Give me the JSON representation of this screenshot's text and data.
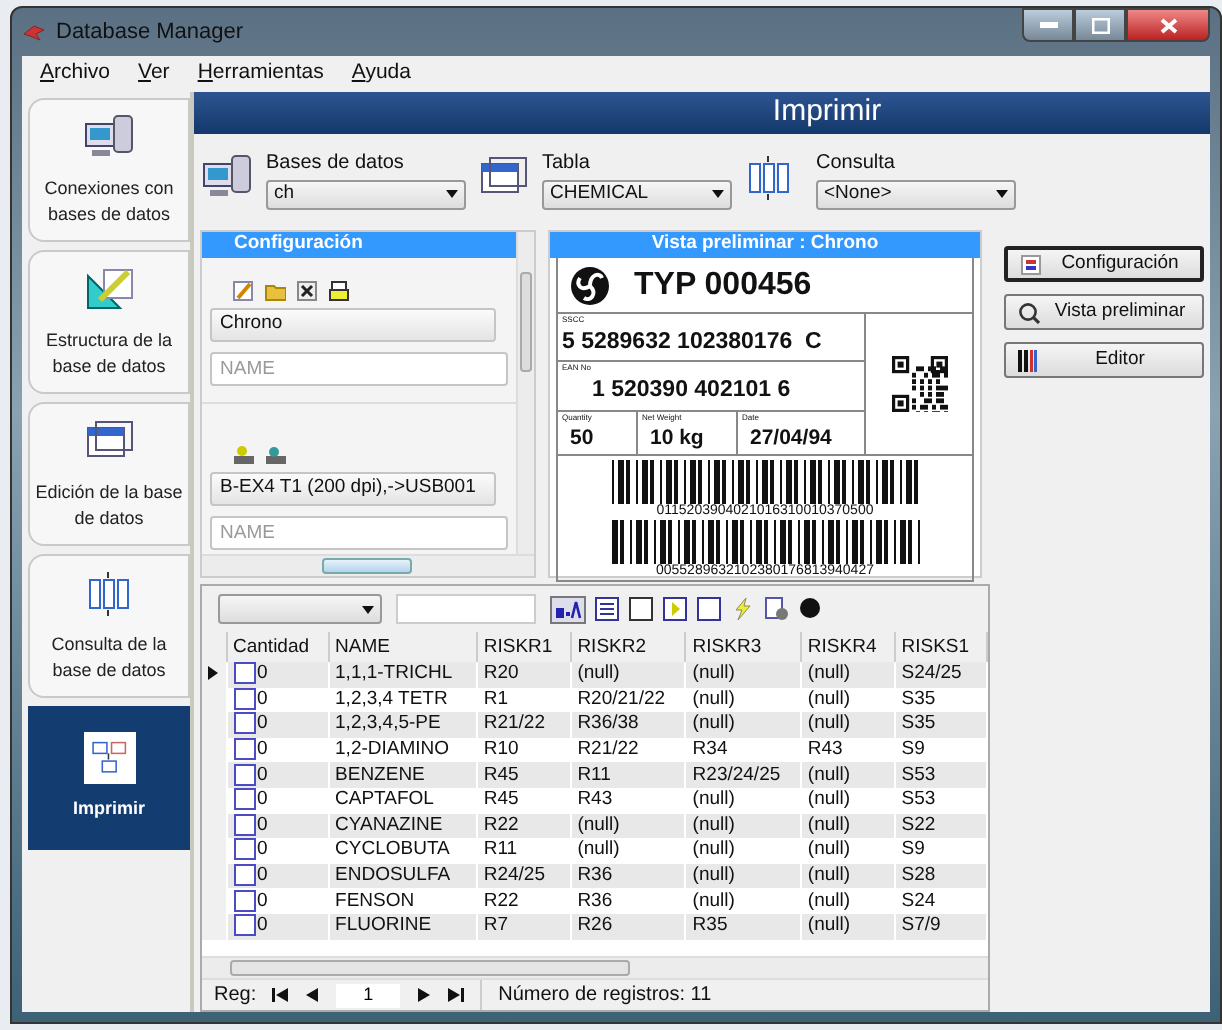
{
  "window": {
    "title": "Database Manager"
  },
  "menu": [
    {
      "label": "Archivo"
    },
    {
      "label": "Ver"
    },
    {
      "label": "Herramientas"
    },
    {
      "label": "Ayuda"
    }
  ],
  "sidebar": {
    "items": [
      {
        "label": "Conexiones con bases de datos",
        "selected": false
      },
      {
        "label": "Estructura de la base de datos",
        "selected": false
      },
      {
        "label": "Edición de la base de datos",
        "selected": false
      },
      {
        "label": "Consulta de la base de datos",
        "selected": false
      },
      {
        "label": "Imprimir",
        "selected": true
      }
    ]
  },
  "header": {
    "title": "Imprimir"
  },
  "selectors": [
    {
      "label": "Bases de datos",
      "value": "ch"
    },
    {
      "label": "Tabla",
      "value": "CHEMICAL"
    },
    {
      "label": "Consulta",
      "value": "<None>"
    }
  ],
  "config_panel": {
    "title": "Configuración",
    "sections": [
      {
        "value": "Chrono",
        "placeholder": "NAME"
      },
      {
        "value": "B-EX4 T1 (200 dpi),->USB001",
        "placeholder": "NAME"
      }
    ]
  },
  "preview": {
    "title": "Vista preliminar : Chrono",
    "label": {
      "heading": "TYP 000456",
      "sscc_label": "SSCC",
      "sscc": "5 5289632 102380176  C",
      "ean_label": "EAN No",
      "ean": "1 520390 402101 6",
      "quantity_label": "Quantity",
      "quantity": "50",
      "weight_label": "Net Weight",
      "weight": "10 kg",
      "date_label": "Date",
      "date": "27/04/94",
      "barcode_1": "0115203904021016310010370500",
      "barcode_2": "0055289632102380176813940427"
    }
  },
  "actions": [
    {
      "label": "Configuración",
      "focused": true
    },
    {
      "label": "Vista preliminar",
      "focused": false
    },
    {
      "label": "Editor",
      "focused": false
    }
  ],
  "table": {
    "columns": [
      "Cantidad",
      "NAME",
      "RISKR1",
      "RISKR2",
      "RISKR3",
      "RISKR4",
      "RISKS1"
    ],
    "rows": [
      {
        "current": true,
        "checked": false,
        "cells": [
          "0",
          "1,1,1-TRICHL",
          "R20",
          "(null)",
          "(null)",
          "(null)",
          "S24/25"
        ]
      },
      {
        "current": false,
        "checked": false,
        "cells": [
          "0",
          "1,2,3,4 TETR",
          "R1",
          "R20/21/22",
          "(null)",
          "(null)",
          "S35"
        ]
      },
      {
        "current": false,
        "checked": false,
        "cells": [
          "0",
          "1,2,3,4,5-PE",
          "R21/22",
          "R36/38",
          "(null)",
          "(null)",
          "S35"
        ]
      },
      {
        "current": false,
        "checked": false,
        "cells": [
          "0",
          "1,2-DIAMINO",
          "R10",
          "R21/22",
          "R34",
          "R43",
          "S9"
        ]
      },
      {
        "current": false,
        "checked": false,
        "cells": [
          "0",
          "BENZENE",
          "R45",
          "R11",
          "R23/24/25",
          "(null)",
          "S53"
        ]
      },
      {
        "current": false,
        "checked": false,
        "cells": [
          "0",
          "CAPTAFOL",
          "R45",
          "R43",
          "(null)",
          "(null)",
          "S53"
        ]
      },
      {
        "current": false,
        "checked": false,
        "cells": [
          "0",
          "CYANAZINE",
          "R22",
          "(null)",
          "(null)",
          "(null)",
          "S22"
        ]
      },
      {
        "current": false,
        "checked": false,
        "cells": [
          "0",
          "CYCLOBUTA",
          "R11",
          "(null)",
          "(null)",
          "(null)",
          "S9"
        ]
      },
      {
        "current": false,
        "checked": false,
        "cells": [
          "0",
          "ENDOSULFA",
          "R24/25",
          "R36",
          "(null)",
          "(null)",
          "S28"
        ]
      },
      {
        "current": false,
        "checked": false,
        "cells": [
          "0",
          "FENSON",
          "R22",
          "R36",
          "(null)",
          "(null)",
          "S24"
        ]
      },
      {
        "current": false,
        "checked": false,
        "cells": [
          "0",
          "FLUORINE",
          "R7",
          "R26",
          "R35",
          "(null)",
          "S7/9"
        ]
      }
    ]
  },
  "navigator": {
    "label": "Reg:",
    "page": "1",
    "count": "Número de registros: 11"
  }
}
